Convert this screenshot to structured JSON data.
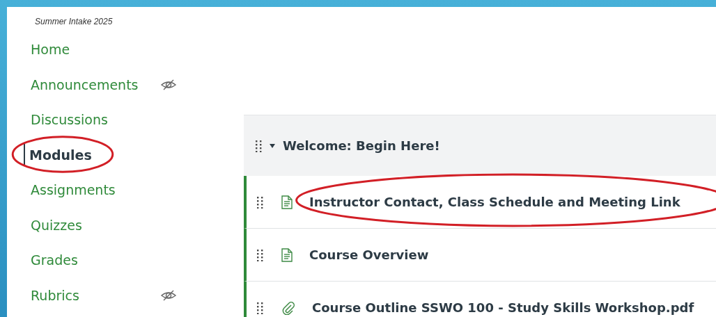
{
  "course": {
    "title": "Summer Intake 2025"
  },
  "sidebar": {
    "items": [
      {
        "label": "Home",
        "selected": false,
        "hidden": false,
        "circled": false
      },
      {
        "label": "Announcements",
        "selected": false,
        "hidden": true,
        "circled": false
      },
      {
        "label": "Discussions",
        "selected": false,
        "hidden": false,
        "circled": false
      },
      {
        "label": "Modules",
        "selected": true,
        "hidden": false,
        "circled": true
      },
      {
        "label": "Assignments",
        "selected": false,
        "hidden": false,
        "circled": false
      },
      {
        "label": "Quizzes",
        "selected": false,
        "hidden": false,
        "circled": false
      },
      {
        "label": "Grades",
        "selected": false,
        "hidden": false,
        "circled": false
      },
      {
        "label": "Rubrics",
        "selected": false,
        "hidden": true,
        "circled": false
      }
    ]
  },
  "module": {
    "title": "Welcome: Begin Here!",
    "expanded": true,
    "items": [
      {
        "kind": "page",
        "title": "Instructor Contact, Class Schedule and Meeting Link",
        "circled": true
      },
      {
        "kind": "page",
        "title": "Course Overview",
        "circled": false
      },
      {
        "kind": "attachment",
        "title": "Course Outline SSWO 100 - Study Skills Workshop.pdf",
        "circled": false
      }
    ]
  }
}
